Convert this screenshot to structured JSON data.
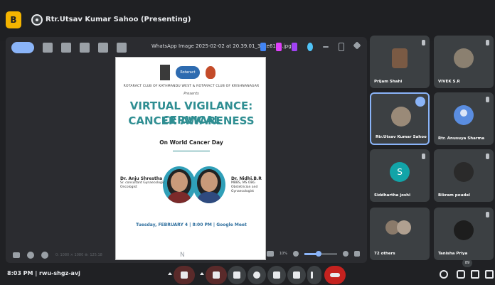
{
  "topbar": {
    "presenting": "Rtr.Utsav Kumar Sahoo (Presenting)",
    "pin_badge": "B"
  },
  "stage": {
    "window_title": "WhatsApp Image 2025-02-02 at 20.39.01_33ce61ab.jpg",
    "zoom": "10%",
    "coords": "0: 1080 × 1080 ⊗: 125.18",
    "middle_glyph": "N"
  },
  "slide": {
    "logo_text": "Rotaract",
    "clubs": "ROTARACT CLUB OF KATHMANDU WEST & ROTARACT CLUB OF KRISHNANAGAR",
    "presents": "Presents",
    "title_line1": "VIRTUAL VIGILANCE: CERVICAL",
    "title_line2": "CANCER AWARENESS",
    "subtitle": "On World Cancer Day",
    "left_name": "Dr. Anju Shrestha",
    "left_role": "Sr. consultant Gynaecologic Oncologist",
    "right_name": "Dr. Nidhi.B.R",
    "right_role": "MBBS, MS OBG Obstetrician and Gynaecologist",
    "when": "Tuesday, FEBRUARY 4 | 8:00 PM | Google Meet"
  },
  "participants": [
    {
      "name": "Prijam Shahi"
    },
    {
      "name": "VIVEK S.R"
    },
    {
      "name": "Rtr.Utsav Kumar Sahoo"
    },
    {
      "name": "Rtr. Anusuya Sharma"
    },
    {
      "name": "Siddhartha joshi",
      "initial": "S"
    },
    {
      "name": "Bikram poudel"
    },
    {
      "name": "72 others"
    },
    {
      "name": "Tanisha Priya"
    }
  ],
  "bottom": {
    "time": "8:03 PM",
    "divider": "|",
    "code": "rwu-shgz-avj",
    "count_badge": "89"
  },
  "colors": {
    "accent": "#8ab4f8",
    "end_call": "#c5221f",
    "teal": "#2f8e92",
    "background": "#202124"
  }
}
